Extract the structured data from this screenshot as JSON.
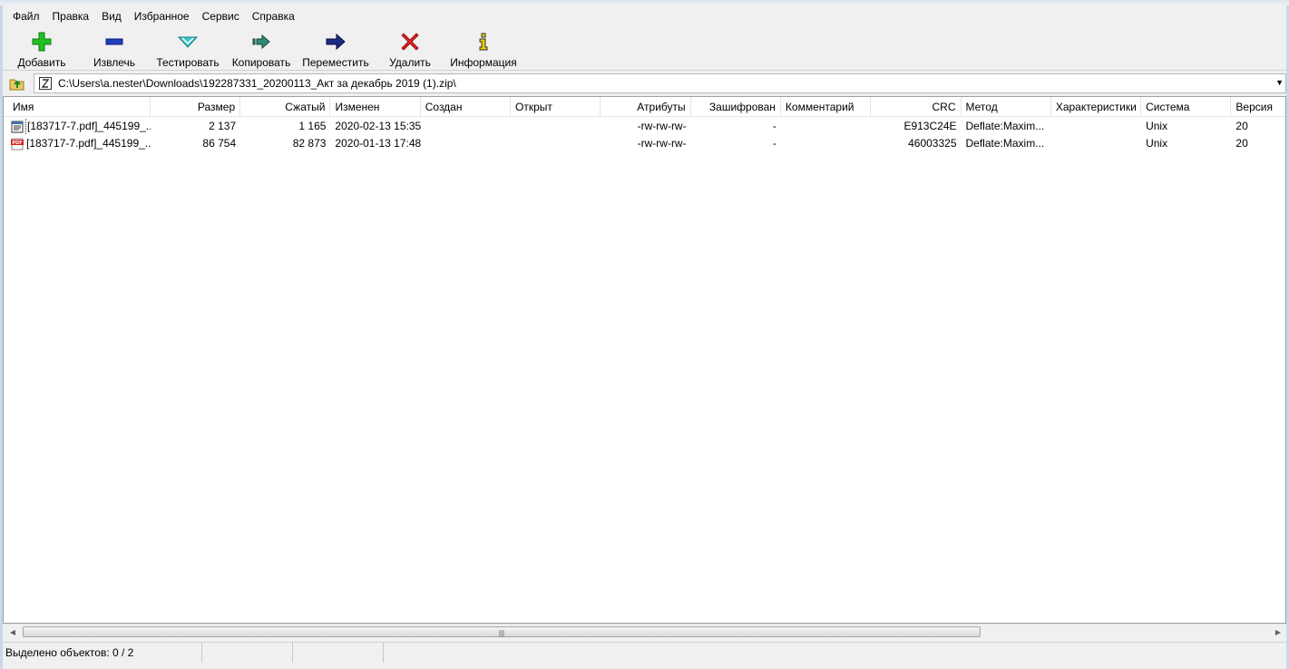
{
  "menu": [
    "Файл",
    "Правка",
    "Вид",
    "Избранное",
    "Сервис",
    "Справка"
  ],
  "toolbar": [
    {
      "label": "Добавить",
      "icon": "plus-icon",
      "color": "#22c022"
    },
    {
      "label": "Извлечь",
      "icon": "minus-icon",
      "color": "#1f3fbf"
    },
    {
      "label": "Тестировать",
      "icon": "check-icon",
      "color": "#3cc6d0"
    },
    {
      "label": "Копировать",
      "icon": "copy-arrow-icon",
      "color": "#2f8a7a"
    },
    {
      "label": "Переместить",
      "icon": "move-arrow-icon",
      "color": "#1c2a80"
    },
    {
      "label": "Удалить",
      "icon": "delete-x-icon",
      "color": "#e02020"
    },
    {
      "label": "Информация",
      "icon": "info-icon",
      "color": "#e8d000"
    }
  ],
  "address": {
    "path": "C:\\Users\\a.nester\\Downloads\\192287331_20200113_Акт за декабрь 2019 (1).zip\\"
  },
  "columns": [
    "Имя",
    "Размер",
    "Сжатый",
    "Изменен",
    "Создан",
    "Открыт",
    "Атрибуты",
    "Зашифрован",
    "Комментарий",
    "CRC",
    "Метод",
    "Характеристики",
    "Система",
    "Версия"
  ],
  "rows": [
    {
      "icon": "document-file-icon",
      "name": "[183717-7.pdf]_445199_...",
      "size": "2 137",
      "packed": "1 165",
      "modified": "2020-02-13 15:35",
      "created": "",
      "accessed": "",
      "attributes": "-rw-rw-rw-",
      "encrypted": "-",
      "comment": "",
      "crc": "E913C24E",
      "method": "Deflate:Maxim...",
      "characteristics": "",
      "host_os": "Unix",
      "version": "20"
    },
    {
      "icon": "pdf-file-icon",
      "name": "[183717-7.pdf]_445199_...",
      "size": "86 754",
      "packed": "82 873",
      "modified": "2020-01-13 17:48",
      "created": "",
      "accessed": "",
      "attributes": "-rw-rw-rw-",
      "encrypted": "-",
      "comment": "",
      "crc": "46003325",
      "method": "Deflate:Maxim...",
      "characteristics": "",
      "host_os": "Unix",
      "version": "20"
    }
  ],
  "status": {
    "selected": "Выделено объектов: 0 / 2",
    "cell2": "",
    "cell3": "",
    "cell4": ""
  }
}
